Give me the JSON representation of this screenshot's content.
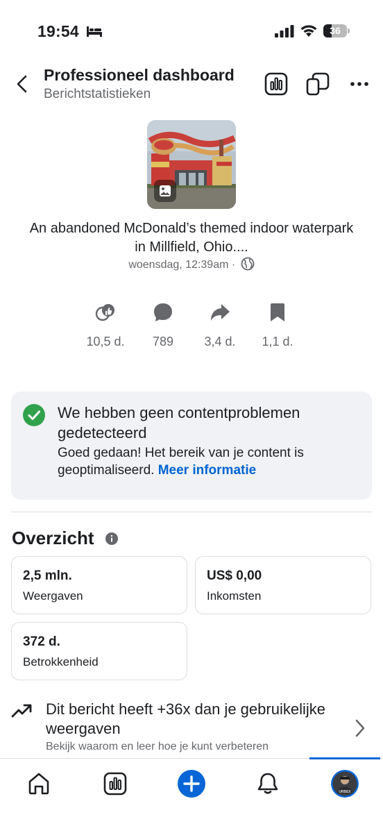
{
  "status_bar": {
    "time": "19:54",
    "battery_level": "36",
    "icons": [
      "bed-icon",
      "signal-icon",
      "wifi-icon",
      "battery-icon"
    ]
  },
  "header": {
    "title": "Professioneel dashboard",
    "subtitle": "Berichtstatistieken",
    "icons": [
      "back-icon",
      "insights-icon",
      "copy-icon",
      "more-icon"
    ]
  },
  "post": {
    "caption": "An abandoned McDonald’s themed indoor waterpark in Millfield, Ohio....",
    "timestamp": "woensdag, 12:39am · ",
    "privacy_icon": "globe-icon"
  },
  "engagement": [
    {
      "icon": "reactions-icon",
      "value": "10,5 d."
    },
    {
      "icon": "comments-icon",
      "value": "789"
    },
    {
      "icon": "shares-icon",
      "value": "3,4 d."
    },
    {
      "icon": "saves-icon",
      "value": "1,1 d."
    }
  ],
  "notice": {
    "title": "We hebben geen contentproblemen gedetecteerd",
    "body": "Goed gedaan! Het bereik van je content is geoptimaliseerd.",
    "link": "Meer informatie",
    "accent": "#31a24c"
  },
  "overview": {
    "title": "Overzicht",
    "metrics": [
      {
        "value": "2,5 mln.",
        "label": "Weergaven"
      },
      {
        "value": "US$ 0,00",
        "label": "Inkomsten"
      },
      {
        "value": "372 d.",
        "label": "Betrokkenheid"
      }
    ]
  },
  "insight": {
    "title": "Dit bericht heeft +36x dan je gebruikelijke weergaven",
    "subtitle": "Bekijk waarom en leer hoe je kunt verbeteren"
  },
  "bottom_nav": {
    "items": [
      "home-icon",
      "insights-icon",
      "create-icon",
      "notifications-icon",
      "profile-avatar"
    ],
    "active": "profile-avatar",
    "avatar_text": "URBEX",
    "accent": "#0a66d6"
  }
}
